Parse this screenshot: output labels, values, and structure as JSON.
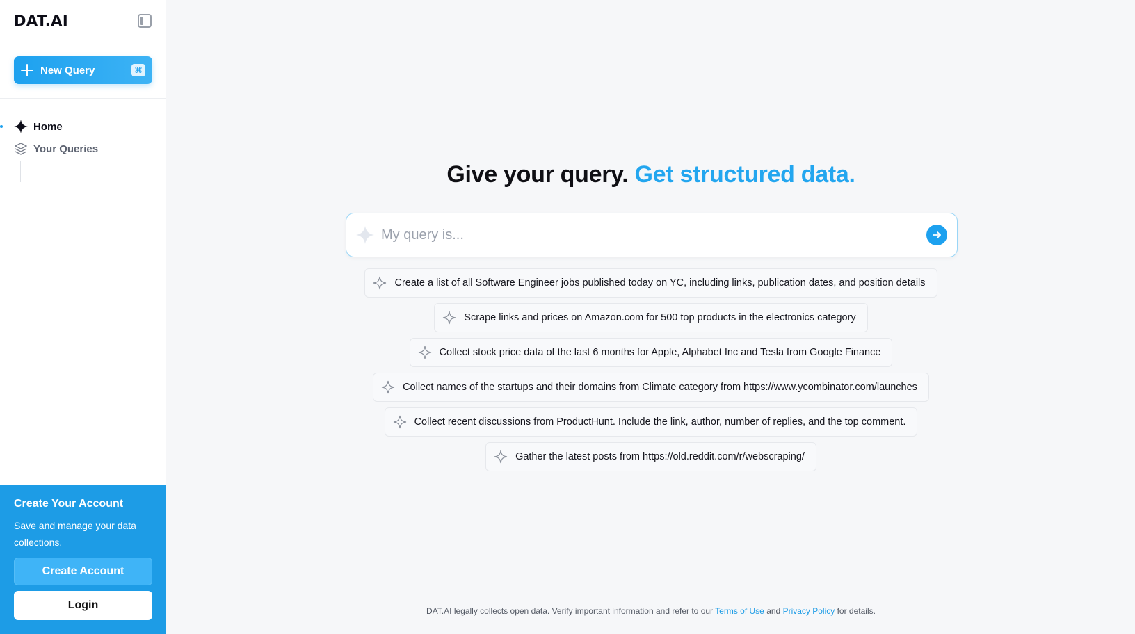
{
  "app": {
    "brand": "DAT.AI"
  },
  "sidebar": {
    "new_query_label": "New Query",
    "shortcut": "⌘",
    "nav": [
      {
        "label": "Home",
        "icon": "sparkle-icon",
        "active": true
      },
      {
        "label": "Your Queries",
        "icon": "layers-icon",
        "active": false
      }
    ],
    "account": {
      "title": "Create Your Account",
      "description": "Save and manage your data collections.",
      "create_label": "Create Account",
      "login_label": "Login"
    }
  },
  "main": {
    "headline_primary": "Give your query.",
    "headline_accent": "Get structured data.",
    "query_placeholder": "My query is...",
    "suggestions": [
      "Create a list of all Software Engineer jobs published today on YC, including links, publication dates, and position details",
      "Scrape links and prices on Amazon.com for 500 top products in the electronics category",
      "Collect stock price data of the last 6 months for Apple, Alphabet Inc and Tesla from Google Finance",
      "Collect names of the startups and their domains from Climate category from https://www.ycombinator.com/launches",
      "Collect recent discussions from ProductHunt. Include the link, author, number of replies, and the top comment.",
      "Gather the latest posts from https://old.reddit.com/r/webscraping/"
    ]
  },
  "footer": {
    "text_before": "DAT.AI legally collects open data. Verify important information and refer to our",
    "terms_label": "Terms of Use",
    "and": "and",
    "privacy_label": "Privacy Policy",
    "text_after": "for details."
  },
  "colors": {
    "accent": "#1da1ef",
    "card": "#1d9ce6"
  }
}
